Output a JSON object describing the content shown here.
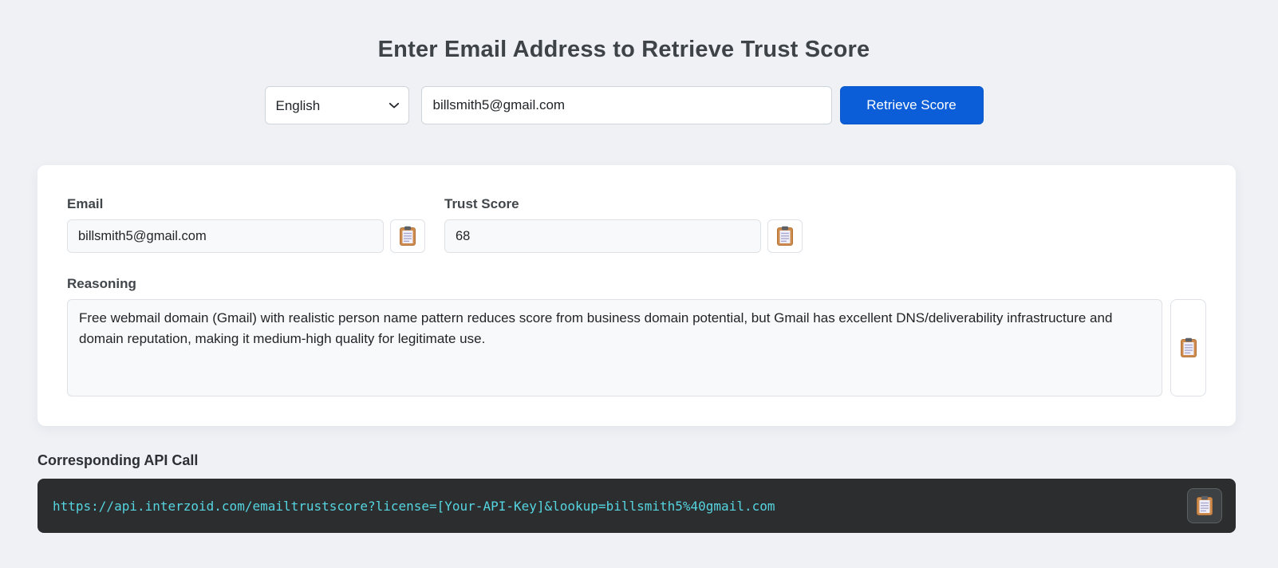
{
  "header": {
    "title": "Enter Email Address to Retrieve Trust Score"
  },
  "controls": {
    "language_select": {
      "selected": "English"
    },
    "email_input": {
      "value": "billsmith5@gmail.com"
    },
    "retrieve_button": {
      "label": "Retrieve Score"
    }
  },
  "result_card": {
    "email": {
      "label": "Email",
      "value": "billsmith5@gmail.com"
    },
    "trust_score": {
      "label": "Trust Score",
      "value": "68"
    },
    "reasoning": {
      "label": "Reasoning",
      "value": "Free webmail domain (Gmail) with realistic person name pattern reduces score from business domain potential, but Gmail has excellent DNS/deliverability infrastructure and domain reputation, making it medium-high quality for legitimate use."
    }
  },
  "api_section": {
    "heading": "Corresponding API Call",
    "url": "https://api.interzoid.com/emailtrustscore?license=[Your-API-Key]&lookup=billsmith5%40gmail.com"
  },
  "icons": {
    "copy_buttons": "clipboard-icon",
    "select_arrow": "chevron-down-icon"
  },
  "colors": {
    "accent_blue": "#0b5ed7",
    "page_background": "#eff1f5",
    "code_bar_background": "#2b2d2e",
    "code_text": "#56d5e1",
    "field_background": "#f8f9fa"
  }
}
